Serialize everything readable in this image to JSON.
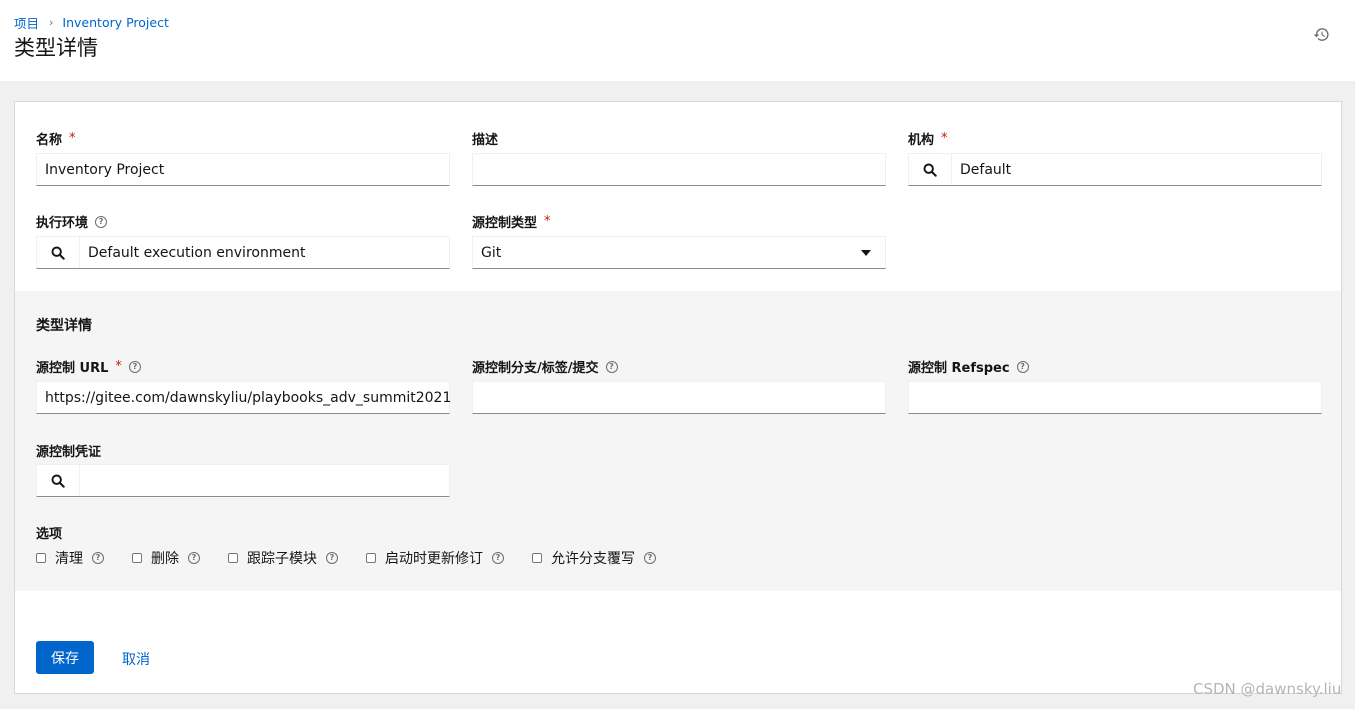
{
  "breadcrumb": {
    "root": "项目",
    "current": "Inventory Project"
  },
  "page": {
    "title": "类型详情"
  },
  "form": {
    "name": {
      "label": "名称",
      "required_mark": "*",
      "value": "Inventory Project"
    },
    "description": {
      "label": "描述",
      "value": ""
    },
    "organization": {
      "label": "机构",
      "required_mark": "*",
      "value": "Default"
    },
    "execution_environment": {
      "label": "执行环境",
      "value": "Default execution environment"
    },
    "scm_type": {
      "label": "源控制类型",
      "required_mark": "*",
      "value": "Git"
    }
  },
  "subform": {
    "title": "类型详情",
    "scm_url": {
      "label": "源控制 URL",
      "required_mark": "*",
      "value": "https://gitee.com/dawnskyliu/playbooks_adv_summit2021"
    },
    "scm_branch": {
      "label": "源控制分支/标签/提交",
      "value": ""
    },
    "scm_refspec": {
      "label": "源控制 Refspec",
      "value": ""
    },
    "scm_credential": {
      "label": "源控制凭证",
      "value": ""
    },
    "options_label": "选项",
    "options": [
      {
        "label": "清理",
        "checked": false
      },
      {
        "label": "删除",
        "checked": false
      },
      {
        "label": "跟踪子模块",
        "checked": false
      },
      {
        "label": "启动时更新修订",
        "checked": false
      },
      {
        "label": "允许分支覆写",
        "checked": false
      }
    ]
  },
  "actions": {
    "save": "保存",
    "cancel": "取消"
  },
  "watermark": "CSDN @dawnsky.liu",
  "icons": {
    "history": "history-icon",
    "search": "search-icon",
    "help": "help-icon",
    "dropdown": "caret-down-icon"
  },
  "colors": {
    "primary": "#0066cc",
    "required": "#c9190b",
    "background": "#f0f0f0"
  }
}
